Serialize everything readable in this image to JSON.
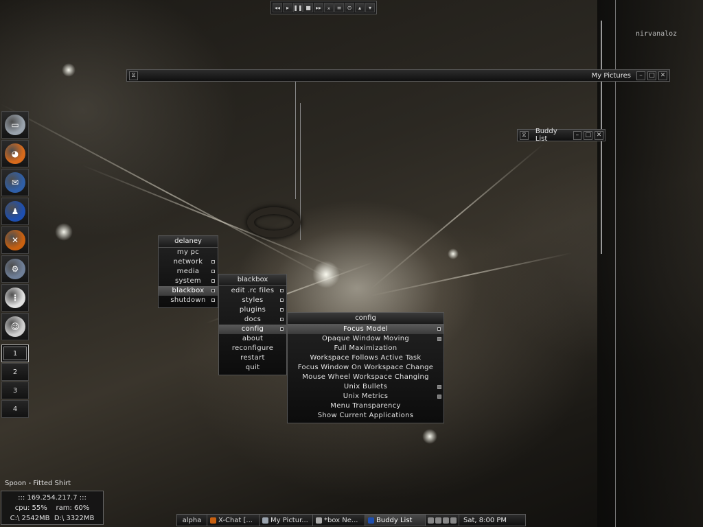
{
  "media_bar": {
    "buttons": [
      {
        "name": "rewind-icon",
        "glyph": "◂◂"
      },
      {
        "name": "prev-icon",
        "glyph": "▸"
      },
      {
        "name": "pause-icon",
        "glyph": "❚❚"
      },
      {
        "name": "stop-icon",
        "glyph": "■"
      },
      {
        "name": "next-icon",
        "glyph": "▸▸"
      },
      {
        "name": "eject-icon",
        "glyph": "⌅"
      },
      {
        "name": "list-icon",
        "glyph": "≡"
      },
      {
        "name": "settings-icon",
        "glyph": "⊙"
      },
      {
        "name": "up-icon",
        "glyph": "▴"
      },
      {
        "name": "down-icon",
        "glyph": "▾"
      }
    ]
  },
  "windows": {
    "my_pictures": {
      "title": "My Pictures"
    },
    "buddy_list": {
      "title": "Buddy List"
    }
  },
  "desktop_text": {
    "nirvana": "nirvanaloz"
  },
  "dock": {
    "apps": [
      {
        "name": "my-computer-icon",
        "color": "#9aa3ad",
        "glyph": "▭"
      },
      {
        "name": "firefox-icon",
        "color": "#d86a1c",
        "glyph": "◕"
      },
      {
        "name": "thunderbird-icon",
        "color": "#2f5fa8",
        "glyph": "✉"
      },
      {
        "name": "aim-icon",
        "color": "#1e4fb0",
        "glyph": "♟"
      },
      {
        "name": "xchat-icon",
        "color": "#c86010",
        "glyph": "✕"
      },
      {
        "name": "settings-gear-icon",
        "color": "#6f7f98",
        "glyph": "⚙"
      },
      {
        "name": "power-outlet-icon",
        "color": "#e0e0e0",
        "glyph": "⋮"
      },
      {
        "name": "stickman-icon",
        "color": "#cfcfcf",
        "glyph": "☺"
      }
    ],
    "workspaces": [
      "1",
      "2",
      "3",
      "4"
    ],
    "active_workspace": "1"
  },
  "menus": {
    "delaney": {
      "title": "delaney",
      "items": [
        {
          "label": "my pc",
          "submenu": false,
          "selected": false
        },
        {
          "label": "network",
          "submenu": true,
          "selected": false
        },
        {
          "label": "media",
          "submenu": true,
          "selected": false
        },
        {
          "label": "system",
          "submenu": true,
          "selected": false
        },
        {
          "label": "blackbox",
          "submenu": true,
          "selected": true
        },
        {
          "label": "shutdown",
          "submenu": true,
          "selected": false
        }
      ]
    },
    "blackbox": {
      "title": "blackbox",
      "items": [
        {
          "label": "edit .rc files",
          "submenu": true,
          "selected": false
        },
        {
          "label": "styles",
          "submenu": true,
          "selected": false
        },
        {
          "label": "plugins",
          "submenu": true,
          "selected": false
        },
        {
          "label": "docs",
          "submenu": true,
          "selected": false
        },
        {
          "label": "config",
          "submenu": true,
          "selected": true
        },
        {
          "label": "about",
          "submenu": false,
          "selected": false
        },
        {
          "label": "reconfigure",
          "submenu": false,
          "selected": false
        },
        {
          "label": "restart",
          "submenu": false,
          "selected": false
        },
        {
          "label": "quit",
          "submenu": false,
          "selected": false
        }
      ]
    },
    "config": {
      "title": "config",
      "items": [
        {
          "label": "Focus Model",
          "submenu": true,
          "selected": true,
          "checked": false
        },
        {
          "label": "Opaque Window Moving",
          "submenu": false,
          "selected": false,
          "checked": true
        },
        {
          "label": "Full Maximization",
          "submenu": false,
          "selected": false,
          "checked": false
        },
        {
          "label": "Workspace Follows Active Task",
          "submenu": false,
          "selected": false,
          "checked": false
        },
        {
          "label": "Focus Window On Workspace Change",
          "submenu": false,
          "selected": false,
          "checked": false
        },
        {
          "label": "Mouse Wheel Workspace Changing",
          "submenu": false,
          "selected": false,
          "checked": false
        },
        {
          "label": "Unix Bullets",
          "submenu": false,
          "selected": false,
          "checked": true
        },
        {
          "label": "Unix Metrics",
          "submenu": false,
          "selected": false,
          "checked": true
        },
        {
          "label": "Menu Transparency",
          "submenu": false,
          "selected": false,
          "checked": false
        },
        {
          "label": "Show Current Applications",
          "submenu": false,
          "selected": false,
          "checked": false
        }
      ]
    }
  },
  "now_playing": "Spoon - Fitted Shirt",
  "sysinfo": {
    "ip": "::: 169.254.217.7 :::",
    "cpu_ram": "cpu: 55%    ram: 60%",
    "disks": "C:\\ 2542MB  D:\\ 3322MB"
  },
  "taskbar": {
    "tasks": [
      {
        "label": "alpha",
        "icon": "",
        "color": "",
        "active": false
      },
      {
        "label": "X-Chat [...",
        "icon": "xchat-task-icon",
        "color": "#c86010",
        "active": false
      },
      {
        "label": "My Pictur...",
        "icon": "folder-task-icon",
        "color": "#9aa3ad",
        "active": false
      },
      {
        "label": "*box Ne...",
        "icon": "box-task-icon",
        "color": "#aaaaaa",
        "active": false
      },
      {
        "label": "Buddy List",
        "icon": "aim-task-icon",
        "color": "#1e4fb0",
        "active": true
      }
    ],
    "clock": "Sat, 8:00 PM"
  }
}
